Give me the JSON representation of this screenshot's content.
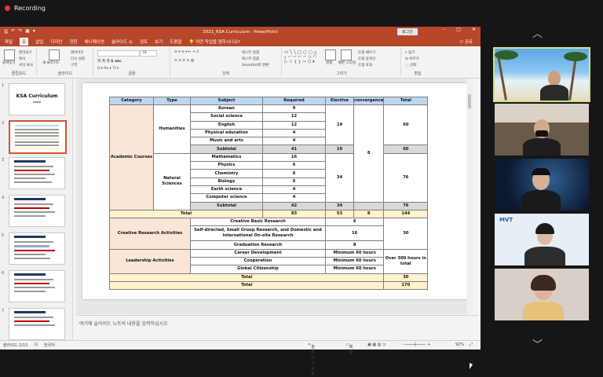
{
  "recording": {
    "label": "Recording"
  },
  "window": {
    "title": "2021_KSA Curriculum  -  PowerPoint",
    "login_button": "로그인",
    "minimize": "–",
    "restore": "□",
    "close": "✕"
  },
  "menu": {
    "items": [
      "파일",
      "홈",
      "삽입",
      "디자인",
      "전환",
      "애니메이션",
      "슬라이드 쇼",
      "검토",
      "보기",
      "도움말"
    ],
    "search": "어떤 작업을 원하시나요?",
    "share": "공유"
  },
  "ribbon": {
    "groups": [
      "클립보드",
      "슬라이드",
      "글꼴",
      "단락",
      "그리기",
      "편집"
    ],
    "paste": "붙여넣기",
    "cut": "잘라내기",
    "copy": "복사",
    "format_painter": "서식 복사",
    "new_slide": "새 슬라이드",
    "layout": "레이아웃",
    "reset": "다시 설정",
    "section": "구역",
    "font_size": "18",
    "text_direction": "텍스트 방향",
    "align_text": "텍스트 맞춤",
    "smartart": "SmartArt로 변환",
    "arrange": "정렬",
    "quick_styles": "빠른 스타일",
    "shape_fill": "도형 채우기",
    "shape_outline": "도형 윤곽선",
    "shape_effects": "도형 효과",
    "find": "찾기",
    "replace": "바꾸기",
    "select": "선택"
  },
  "thumbnails": [
    {
      "num": "1",
      "title": "KSA Curriculum"
    },
    {
      "num": "2",
      "title": ""
    },
    {
      "num": "3",
      "title": "Chacacter of KSA Curriculum"
    },
    {
      "num": "4",
      "title": "Chacacter of KSA Curriculum (1)"
    },
    {
      "num": "5",
      "title": "Chacacter of KSA Curriculum (2)"
    },
    {
      "num": "6",
      "title": "Chacacter of KSA Curriculum (3)"
    },
    {
      "num": "7",
      "title": "Chacacter of KSA Curriculum"
    }
  ],
  "table": {
    "headers": [
      "Category",
      "Type",
      "Subject",
      "Required",
      "Elective",
      "convergence",
      "Total"
    ],
    "academic": "Academic Courses",
    "humanities": "Humanities",
    "natural": "Natural Sciences",
    "hum_rows": [
      [
        "Korean",
        "9"
      ],
      [
        "Social science",
        "12"
      ],
      [
        "English",
        "12"
      ],
      [
        "Physical education",
        "4"
      ],
      [
        "Music and arts",
        "4"
      ]
    ],
    "hum_elective": "19",
    "hum_total": "60",
    "hum_subtotal": [
      "Subtotal",
      "41",
      "19",
      "60"
    ],
    "nat_rows": [
      [
        "Mathematics",
        "16"
      ],
      [
        "Physics",
        "6"
      ],
      [
        "Chemistry",
        "6"
      ],
      [
        "Biology",
        "6"
      ],
      [
        "Earth science",
        "4"
      ],
      [
        "Computer science",
        "4"
      ]
    ],
    "nat_elective": "34",
    "nat_total": "76",
    "nat_subtotal": [
      "Subtotal",
      "42",
      "34",
      "76"
    ],
    "convergence": "8",
    "academic_total": [
      "Total",
      "83",
      "53",
      "8",
      "144"
    ],
    "creative": "Creative Research Activities",
    "creative_rows": [
      [
        "Creative Basic Research",
        "6"
      ],
      [
        "Self-directed, Small Group Research, and Domestic and International On-site Research",
        "16"
      ],
      [
        "Graduation Research",
        "8"
      ]
    ],
    "creative_total": "30",
    "leadership": "Leadership Activities",
    "leader_rows": [
      [
        "Career Development",
        "Minimum 60 hours"
      ],
      [
        "Cooperation",
        "Minimum 60 hours"
      ],
      [
        "Global Citizenship",
        "Minimum 60 hours"
      ]
    ],
    "leader_total": "Over 300 hours in total",
    "total2": [
      "Total",
      "30"
    ],
    "grand_total": [
      "Total",
      "170"
    ]
  },
  "notes": {
    "placeholder": "여기에 슬라이드 노트의 내용을 입력하십시오"
  },
  "status": {
    "slide": "슬라이드 2/13",
    "lang": "한국어",
    "notes_btn": "슬라이드 노트",
    "comments": "메모",
    "zoom": "92%"
  },
  "sidebar": {
    "up": "︿",
    "down": "﹀"
  }
}
